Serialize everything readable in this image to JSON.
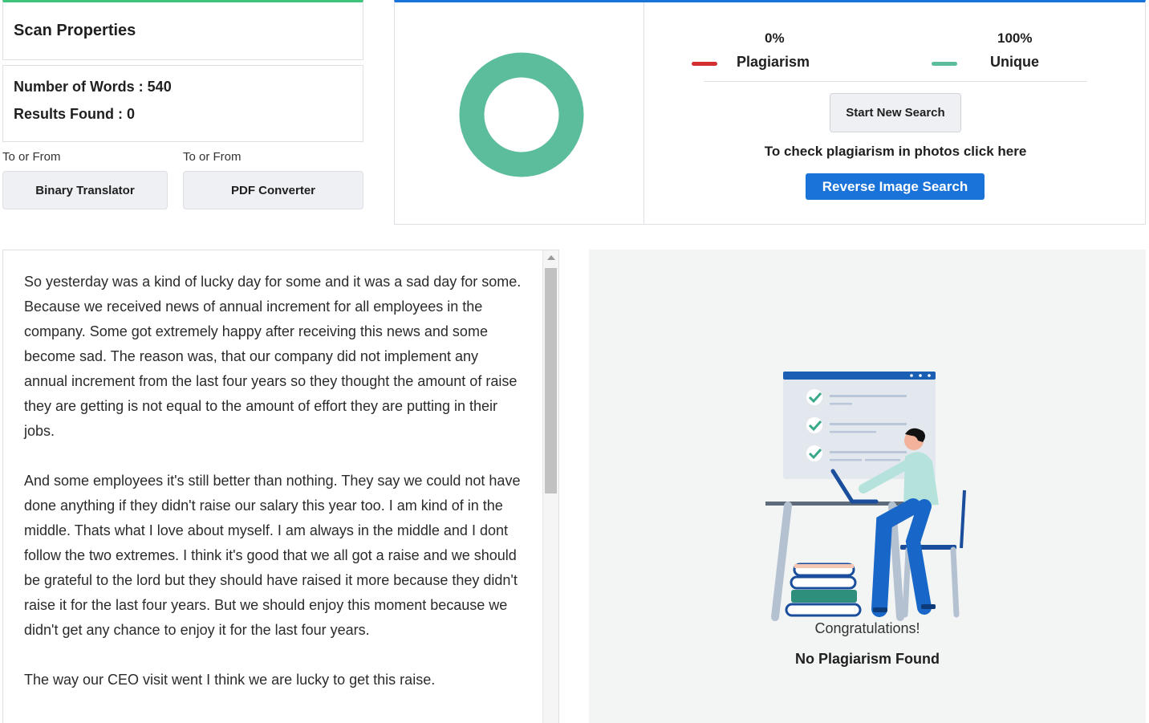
{
  "scan": {
    "title": "Scan Properties",
    "words_label": "Number of Words : ",
    "words_value": "540",
    "results_label": "Results Found : ",
    "results_value": "0"
  },
  "tools": [
    {
      "caption": "To or From",
      "label": "Binary Translator"
    },
    {
      "caption": "To or From",
      "label": "PDF Converter"
    }
  ],
  "summary": {
    "plagiarism_pct": "0%",
    "plagiarism_label": "Plagiarism",
    "unique_pct": "100%",
    "unique_label": "Unique",
    "plagiarism_fraction": 0,
    "unique_fraction": 1,
    "plagiarism_color": "#d32f2f",
    "unique_color": "#5bbd9b",
    "start_button": "Start New Search",
    "photo_text": "To check plagiarism in photos click here",
    "reverse_button": "Reverse Image Search"
  },
  "text": {
    "paragraphs": [
      "So yesterday was a kind of lucky day for some and it was a sad day for some. Because we received news of annual increment for all employees in the company. Some got extremely happy after receiving this news and some become sad. The reason was, that our company did not implement any annual increment from the last four years so they thought the amount of raise they are getting is not equal to the amount of effort they are putting in their jobs.",
      "And some employees it's still better than nothing. They say we could not have done anything if they didn't raise our salary this year too. I am kind of in the middle. Thats what I love about myself. I am always in the middle and I dont follow the two extremes. I think it's good that we all got a raise and we should be grateful to the lord but they should have raised it more because they didn't raise it for the last four years. But we should enjoy this moment because we didn't get any chance to enjoy it for the last four years.",
      "The way our CEO visit went I think we are lucky to get this raise."
    ]
  },
  "result": {
    "congrats": "Congratulations!",
    "message": "No Plagiarism Found"
  }
}
